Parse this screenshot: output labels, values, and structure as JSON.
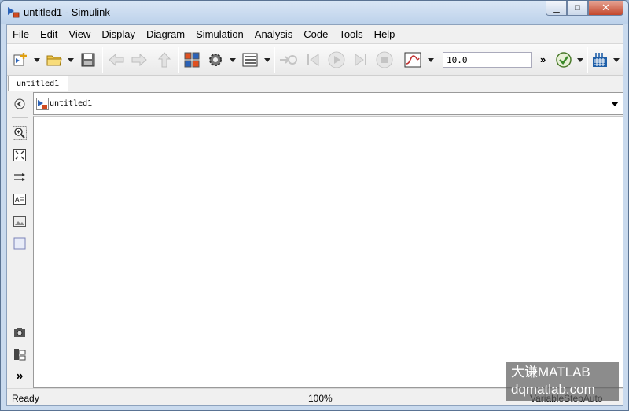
{
  "window": {
    "title": "untitled1 - Simulink"
  },
  "menu": {
    "items": [
      {
        "label": "File",
        "mnemonic": "F",
        "rest": "ile"
      },
      {
        "label": "Edit",
        "mnemonic": "E",
        "rest": "dit"
      },
      {
        "label": "View",
        "mnemonic": "V",
        "rest": "iew"
      },
      {
        "label": "Display",
        "mnemonic": "D",
        "rest": "isplay"
      },
      {
        "label": "Diagram",
        "mnemonic": "",
        "rest": "Diagram"
      },
      {
        "label": "Simulation",
        "mnemonic": "S",
        "rest": "imulation"
      },
      {
        "label": "Analysis",
        "mnemonic": "A",
        "rest": "nalysis"
      },
      {
        "label": "Code",
        "mnemonic": "C",
        "rest": "ode"
      },
      {
        "label": "Tools",
        "mnemonic": "T",
        "rest": "ools"
      },
      {
        "label": "Help",
        "mnemonic": "H",
        "rest": "elp"
      }
    ]
  },
  "toolbar": {
    "stop_time": "10.0",
    "more_label": "»"
  },
  "tabs": {
    "active": "untitled1"
  },
  "address": {
    "path": "untitled1"
  },
  "status": {
    "left": "Ready",
    "zoom": "100%",
    "solver": "VariableStepAuto"
  },
  "watermark": {
    "line1": "大谦MATLAB",
    "line2": "dqmatlab.com"
  },
  "colors": {
    "titlebar": "#c9daee",
    "accent_green": "#3a8a2a",
    "accent_blue": "#1f5fa8"
  }
}
